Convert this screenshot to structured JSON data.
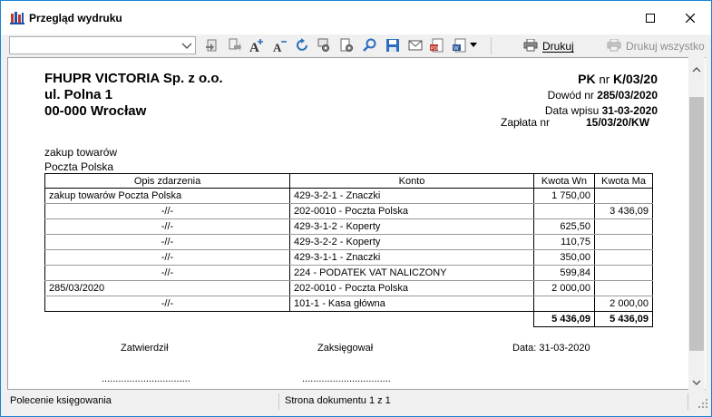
{
  "window": {
    "title": "Przegląd wydruku"
  },
  "toolbar": {
    "combo_value": "",
    "icons": [
      "export-icon",
      "copy-icon",
      "zoom-in-font-icon",
      "zoom-out-font-icon",
      "refresh-icon",
      "settings-icon",
      "page-settings-icon",
      "search-icon",
      "save-icon",
      "email-icon",
      "pdf-icon",
      "export-dropdown-icon"
    ],
    "print_label": "Drukuj",
    "print_all_label": "Drukuj wszystko"
  },
  "document": {
    "company": {
      "name": "FHUPR VICTORIA Sp. z o.o.",
      "street": "ul. Polna 1",
      "city": "00-000 Wrocław"
    },
    "doc_type": "PK",
    "doc_nr_label": "nr",
    "doc_nr": "K/03/20",
    "dowod_label": "Dowód nr",
    "dowod_value": "285/03/2020",
    "data_wpisu_label": "Data wpisu",
    "data_wpisu_value": "31-03-2020",
    "zaplata_label": "Zapłata nr",
    "zaplata_value": "15/03/20/KW",
    "description_line1": "zakup towarów",
    "description_line2": "Poczta Polska",
    "table": {
      "headers": [
        "Opis zdarzenia",
        "Konto",
        "Kwota Wn",
        "Kwota Ma"
      ],
      "rows": [
        {
          "opis": "zakup towarów Poczta Polska",
          "konto": "429-3-2-1 - Znaczki",
          "wn": "1 750,00",
          "ma": ""
        },
        {
          "opis": "-//-",
          "konto": "202-0010 - Poczta Polska",
          "wn": "",
          "ma": "3 436,09"
        },
        {
          "opis": "-//-",
          "konto": "429-3-1-2 - Koperty",
          "wn": "625,50",
          "ma": ""
        },
        {
          "opis": "-//-",
          "konto": "429-3-2-2 - Koperty",
          "wn": "110,75",
          "ma": ""
        },
        {
          "opis": "-//-",
          "konto": "429-3-1-1 - Znaczki",
          "wn": "350,00",
          "ma": ""
        },
        {
          "opis": "-//-",
          "konto": "224 - PODATEK VAT NALICZONY",
          "wn": "599,84",
          "ma": ""
        },
        {
          "opis": "285/03/2020",
          "konto": "202-0010 - Poczta Polska",
          "wn": "2 000,00",
          "ma": ""
        },
        {
          "opis": "-//-",
          "konto": "101-1 - Kasa główna",
          "wn": "",
          "ma": "2 000,00"
        }
      ],
      "total_wn": "5 436,09",
      "total_ma": "5 436,09"
    },
    "signatures": {
      "approved_label": "Zatwierdził",
      "booked_label": "Zaksięgował",
      "date_label": "Data: 31-03-2020",
      "dots": "................................"
    }
  },
  "statusbar": {
    "left": "Polecenie księgowania",
    "page_info": "Strona dokumentu 1 z 1"
  },
  "colors": {
    "title_border": "#1883d7",
    "icon_blue": "#2a6ebd"
  }
}
